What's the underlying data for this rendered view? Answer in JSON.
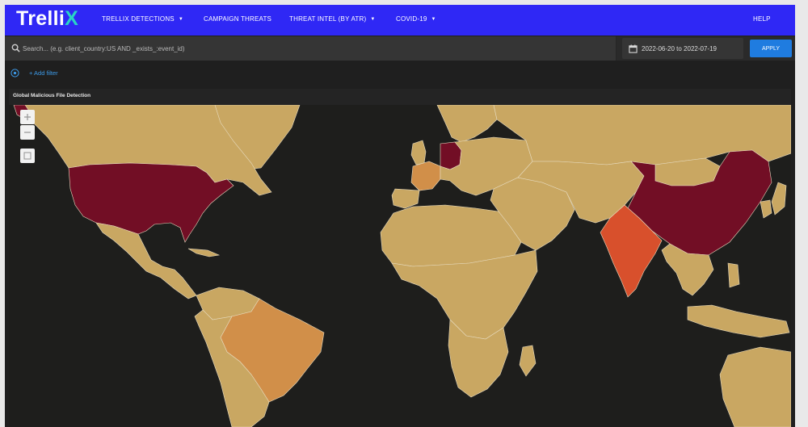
{
  "nav": {
    "logo": "Trelli",
    "logo_accent": "X",
    "items": [
      {
        "label": "TRELLIX DETECTIONS",
        "dropdown": true
      },
      {
        "label": "CAMPAIGN THREATS",
        "dropdown": false
      },
      {
        "label": "THREAT INTEL (BY ATR)",
        "dropdown": true
      },
      {
        "label": "COVID-19",
        "dropdown": true
      }
    ],
    "help": "HELP",
    "caret": "▼"
  },
  "search": {
    "placeholder": "Search... (e.g. client_country:US AND _exists_:event_id)",
    "value": ""
  },
  "date_range": "2022-06-20 to 2022-07-19",
  "apply_label": "APPLY",
  "add_filter_label": "+ Add filter",
  "panel": {
    "title": "Global Malicious File Detection"
  },
  "colors": {
    "nav": "#2f28f5",
    "accent": "#1f7ce0",
    "map_background": "#1e1e1c",
    "country_low": "#c9a762",
    "country_medium_low": "#d18f49",
    "country_medium_high": "#d8502c",
    "country_high": "#720e25"
  },
  "map_data": {
    "type": "choropleth",
    "legend": "none",
    "highlighted_countries": [
      {
        "country": "United States",
        "level": "high"
      },
      {
        "country": "China",
        "level": "high"
      },
      {
        "country": "Germany",
        "level": "high"
      },
      {
        "country": "India",
        "level": "medium_high"
      },
      {
        "country": "France",
        "level": "medium_low"
      },
      {
        "country": "Brazil",
        "level": "medium_low"
      }
    ],
    "default_level": "low"
  },
  "map_controls": [
    "zoom-in",
    "zoom-out",
    "fit-bounds"
  ]
}
